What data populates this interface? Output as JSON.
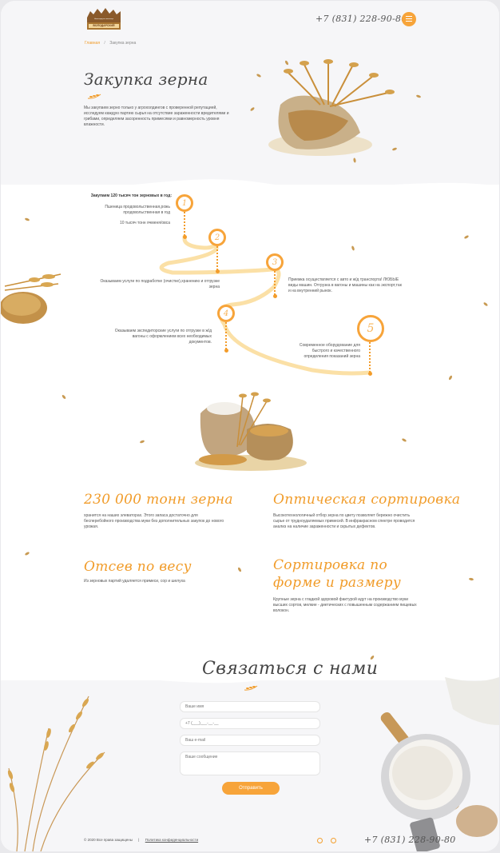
{
  "header": {
    "logo_line1": "Нижегородская мельница",
    "logo_line2": "ВОЛОДАРСКИЙ",
    "phone": "+7 (831) 228-90-80",
    "menu_icon": "hamburger-icon"
  },
  "breadcrumb": {
    "home": "Главная",
    "separator": "/",
    "current": "Закупка зерна"
  },
  "hero": {
    "title": "Закупка зерна",
    "text": "Мы закупаем зерно только у агрохолдингов с проверенной репутацией, исследуем каждую партию сырья на отсутствие зараженности вредителями и грибами, определяем засоренность примесями и равномерность уровня влажности."
  },
  "timeline": {
    "heading": "Закупаем 120 тысяч тон зерновых в год:",
    "step1_text1": "Пшеница продовольственная,рожь продовольственная в год",
    "step1_text2": "10 тысяч тонн ячменя/овса",
    "step2_text": "Оказываем услуги по подработке (очистке),хранению и отгрузке зерна",
    "step3_text": "Приемка осуществляется с авто и ж/д транспорта! ЛЮБЫЕ виды машин. Отгрузка в вагоны и машины как на экспорт,так и на внутренний рынок.",
    "step4_text": "Оказываем экспедиторские услуги по отгрузке в ж/д вагоны с оформлением всех необходимых документов.",
    "step5_text": "Современное оборудование для быстрого и качественного определения показаний зерна",
    "numbers": [
      "1",
      "2",
      "3",
      "4",
      "5"
    ]
  },
  "features": [
    {
      "title": "230 000 тонн зерна",
      "text": "хранится на наших элеваторах. Этого запаса достаточно для бесперебойного производства муки без дополнительных закупок до нового урожая."
    },
    {
      "title": "Оптическая сортировка",
      "text": "Высокотехнологичный отбор зерна по цвету позволяет бережно очистить сырье от трудноудаляемых примесей. В инфракрасном спектре проводится анализ на наличие зараженности и скрытых дефектов."
    },
    {
      "title": "Отсев по весу",
      "text": "Из зерновых партий удаляется примеси, сор и шелуха"
    },
    {
      "title": "Сортировка по форме и размеру",
      "text": "Крупные зерна с гладкой здоровой фактурой идут на производство муки высших сортов, мелкие - диетических с повышенным содержанием пищевых волокон."
    }
  ],
  "contact": {
    "title": "Связаться с нами",
    "name_placeholder": "Ваше имя",
    "phone_placeholder": "+7 (___)___-__-__",
    "email_placeholder": "Ваш e-mail",
    "message_placeholder": "Ваше сообщение",
    "submit_label": "Отправить"
  },
  "footer": {
    "copyright": "© 2020 Все права защищены",
    "separator": "|",
    "privacy": "Политика конфиденциальности",
    "phone": "+7 (831) 228-90-80",
    "social_icons": [
      "vk-icon",
      "instagram-icon"
    ]
  },
  "colors": {
    "accent": "#f19c2a",
    "path": "#fbe0a6",
    "background": "#ffffff",
    "section_gray": "#f6f6f8"
  }
}
